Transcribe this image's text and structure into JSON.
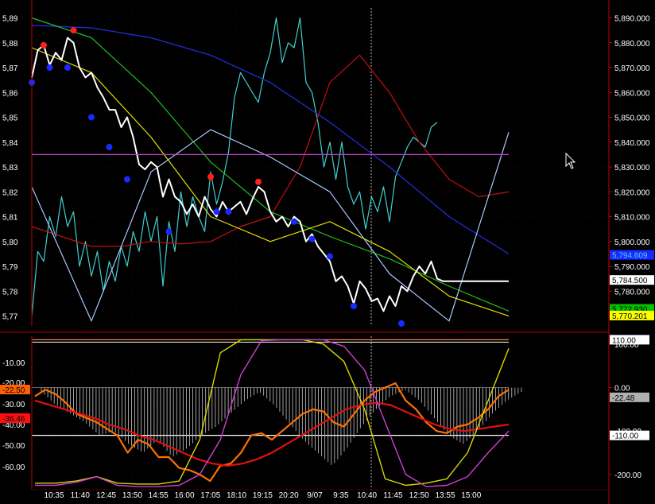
{
  "chart_data": [
    {
      "type": "line",
      "title": "",
      "xlabel": "",
      "ylabel": "",
      "ylim": [
        5766,
        5894
      ],
      "grid": true,
      "x_tick_labels": [
        "10:35",
        "11:40",
        "12:45",
        "13:50",
        "14:55",
        "16:00",
        "17:05",
        "18:10",
        "19:15",
        "20:20",
        "9/07",
        "9:35",
        "10:40",
        "11:45",
        "12:50",
        "13:55",
        "15:00"
      ],
      "y_tick_labels_right": [
        "5,890.000",
        "5,880.000",
        "5,870.000",
        "5,860.000",
        "5,850.000",
        "5,840.000",
        "5,830.000",
        "5,820.000",
        "5,810.000",
        "5,800.000",
        "5,790.000",
        "5,780.000",
        "5,770.000"
      ],
      "y_tick_labels_left": [
        "5,89",
        "5,88",
        "5,87",
        "5,86",
        "5,85",
        "5,84",
        "5,83",
        "5,82",
        "5,81",
        "5,80",
        "5,79",
        "5,78",
        "5,77"
      ],
      "price_tags": [
        {
          "value": "5,794.609",
          "color": "#1a2aff",
          "text_color": "#4ad0ff",
          "y": 5794.6
        },
        {
          "value": "5,784.500",
          "color": "#ffffff",
          "text_color": "#000000",
          "y": 5784.5
        },
        {
          "value": "5,772.930",
          "color": "#00c000",
          "text_color": "#000000",
          "y": 5772.9
        },
        {
          "value": "5,770.201",
          "color": "#ffff00",
          "text_color": "#000000",
          "y": 5770.2
        }
      ],
      "horizontal_line": {
        "y": 5835.0,
        "color": "#c040c0"
      },
      "series": [
        {
          "color": "#ffffff",
          "x": [
            0,
            1,
            2,
            3,
            4,
            5,
            6,
            7,
            8,
            9,
            10,
            11,
            12,
            13,
            14,
            15,
            16,
            17,
            18,
            19,
            20,
            21,
            22,
            23,
            24,
            25,
            26,
            27,
            28,
            29,
            30,
            31,
            32,
            33,
            34,
            35,
            36,
            37,
            38,
            39,
            40,
            41,
            42,
            43,
            44,
            45,
            46,
            47,
            48,
            49,
            50,
            51,
            52,
            53,
            54,
            55,
            56,
            57,
            58,
            59,
            60,
            61,
            62,
            63,
            64,
            65,
            66,
            67,
            68,
            69,
            70,
            71,
            72,
            73,
            74,
            75,
            76,
            77,
            78,
            79,
            80
          ],
          "values": [
            5866,
            5877,
            5879,
            5871,
            5876,
            5873,
            5882,
            5880,
            5870,
            5866,
            5868,
            5862,
            5858,
            5853,
            5853,
            5846,
            5850,
            5842,
            5831,
            5829,
            5832,
            5830,
            5818,
            5825,
            5818,
            5816,
            5811,
            5815,
            5810,
            5818,
            5813,
            5810,
            5816,
            5812,
            5814,
            5816,
            5811,
            5817,
            5822,
            5820,
            5812,
            5808,
            5810,
            5806,
            5810,
            5808,
            5800,
            5803,
            5798,
            5795,
            5792,
            5784,
            5786,
            5782,
            5775,
            5784,
            5781,
            5776,
            5777,
            5772,
            5778,
            5774,
            5782,
            5780,
            5786,
            5790,
            5787,
            5792,
            5785,
            5784,
            5784,
            5784,
            5784,
            5784,
            5784,
            5784,
            5784,
            5784,
            5784,
            5784,
            5784
          ]
        },
        {
          "color": "#40d0d0",
          "x": [
            0,
            1,
            2,
            3,
            4,
            5,
            6,
            7,
            8,
            9,
            10,
            11,
            12,
            13,
            14,
            15,
            16,
            17,
            18,
            19,
            20,
            21,
            22,
            23,
            24,
            25,
            26,
            27,
            28,
            29,
            30,
            31,
            32,
            33,
            34,
            35,
            36,
            37,
            38,
            39,
            40,
            41,
            42,
            43,
            44,
            45,
            46,
            47,
            48,
            49,
            50,
            51,
            52,
            53,
            54,
            55,
            56,
            57,
            58,
            59,
            60,
            61,
            62,
            63,
            64,
            65,
            66,
            67,
            68
          ],
          "values": [
            5770,
            5796,
            5792,
            5810,
            5802,
            5818,
            5806,
            5812,
            5790,
            5800,
            5786,
            5796,
            5780,
            5792,
            5784,
            5798,
            5790,
            5804,
            5796,
            5812,
            5800,
            5810,
            5782,
            5808,
            5796,
            5820,
            5806,
            5818,
            5810,
            5804,
            5828,
            5815,
            5824,
            5836,
            5858,
            5868,
            5864,
            5860,
            5856,
            5868,
            5876,
            5890,
            5872,
            5880,
            5878,
            5890,
            5864,
            5860,
            5848,
            5830,
            5840,
            5825,
            5840,
            5822,
            5815,
            5820,
            5805,
            5818,
            5812,
            5822,
            5808,
            5826,
            5832,
            5838,
            5842,
            5840,
            5838,
            5846,
            5848
          ]
        },
        {
          "color": "#c01010",
          "x": [
            0,
            5,
            10,
            15,
            20,
            25,
            30,
            35,
            40,
            45,
            50,
            55,
            60,
            65,
            70,
            75,
            80
          ],
          "values": [
            5806,
            5802,
            5798,
            5798,
            5800,
            5799,
            5800,
            5806,
            5810,
            5830,
            5864,
            5875,
            5860,
            5840,
            5825,
            5818,
            5820
          ]
        },
        {
          "color": "#2030e0",
          "x": [
            0,
            10,
            20,
            30,
            40,
            50,
            60,
            70,
            80
          ],
          "values": [
            5887,
            5886,
            5882,
            5875,
            5864,
            5848,
            5830,
            5810,
            5795
          ]
        },
        {
          "color": "#20c020",
          "x": [
            0,
            10,
            20,
            30,
            40,
            50,
            60,
            70,
            80
          ],
          "values": [
            5890,
            5882,
            5860,
            5832,
            5812,
            5802,
            5793,
            5782,
            5772
          ]
        },
        {
          "color": "#e0e000",
          "x": [
            0,
            10,
            20,
            30,
            40,
            50,
            60,
            70,
            80
          ],
          "values": [
            5878,
            5868,
            5842,
            5810,
            5800,
            5808,
            5796,
            5778,
            5770
          ]
        },
        {
          "color": "#a8c8ff",
          "x": [
            0,
            10,
            20,
            30,
            40,
            50,
            60,
            70,
            80
          ],
          "values": [
            5822,
            5768,
            5828,
            5845,
            5834,
            5820,
            5787,
            5768,
            5844
          ]
        }
      ],
      "dots": [
        {
          "color": "#ff2020",
          "points": [
            [
              2,
              5879
            ],
            [
              7,
              5885
            ],
            [
              30,
              5826
            ],
            [
              38,
              5824
            ]
          ]
        },
        {
          "color": "#1a2aff",
          "points": [
            [
              0,
              5864
            ],
            [
              3,
              5870
            ],
            [
              6,
              5870
            ],
            [
              10,
              5850
            ],
            [
              13,
              5838
            ],
            [
              16,
              5825
            ],
            [
              23,
              5804
            ],
            [
              31,
              5812
            ],
            [
              33,
              5812
            ],
            [
              44,
              5808
            ],
            [
              47,
              5801
            ],
            [
              50,
              5794
            ],
            [
              54,
              5774
            ],
            [
              62,
              5767
            ]
          ]
        }
      ]
    },
    {
      "type": "line",
      "title": "",
      "xlabel": "",
      "ylabel": "",
      "ylim": [
        -235,
        118
      ],
      "y_tick_labels_left": [
        "-10.00",
        "-20.00",
        "-30.00",
        "-40.00",
        "-50.00",
        "-60.00"
      ],
      "y_tick_labels_right": [
        "100.00",
        "0.00",
        "-100.00",
        "-200.00"
      ],
      "value_tags_left": [
        {
          "value": "-22.50",
          "color": "#ff6000"
        },
        {
          "value": "-36.46",
          "color": "#ff1010"
        }
      ],
      "value_tags_right": [
        {
          "value": "110.00",
          "color": "#ffffff"
        },
        {
          "value": "-22.48",
          "color": "#b0b0b0"
        },
        {
          "value": "-110.00",
          "color": "#ffffff"
        }
      ],
      "reference_levels": [
        110,
        -110
      ],
      "series": [
        {
          "color": "#ff7000",
          "values": [
            -20,
            -5,
            -15,
            -35,
            -60,
            -70,
            -80,
            -95,
            -110,
            -150,
            -120,
            -130,
            -160,
            -160,
            -185,
            -190,
            -200,
            -215,
            -180,
            -175,
            -150,
            -110,
            -105,
            -120,
            -100,
            -80,
            -60,
            -50,
            -55,
            -80,
            -90,
            -60,
            -30,
            -10,
            0,
            10,
            -30,
            -50,
            -80,
            -100,
            -105,
            -90,
            -85,
            -70,
            -50,
            -20,
            -5
          ]
        },
        {
          "color": "#e01010",
          "values": [
            -30,
            -40,
            -50,
            -60,
            -70,
            -85,
            -95,
            -110,
            -120,
            -135,
            -150,
            -165,
            -175,
            -180,
            -175,
            -165,
            -150,
            -130,
            -110,
            -90,
            -70,
            -50,
            -40,
            -35,
            -40,
            -55,
            -70,
            -85,
            -95,
            -100,
            -95,
            -90,
            -85
          ]
        },
        {
          "color": "#e0e0e0",
          "values": [
            -10,
            -40,
            -60,
            -80,
            -110,
            -100,
            -130,
            -150,
            -120,
            -160,
            -140,
            -110,
            -90,
            -60,
            -30,
            -10,
            -40,
            -80,
            -120,
            -150,
            -180,
            -140,
            -90,
            -50,
            -20,
            -5,
            -30,
            -70,
            -110,
            -130,
            -100,
            -60,
            -30,
            -10
          ]
        },
        {
          "color": "#d8d800",
          "values": [
            -220,
            -220,
            -215,
            -205,
            -220,
            -222,
            -222,
            -215,
            -120,
            80,
            110,
            110,
            110,
            110,
            100,
            60,
            -50,
            -210,
            -225,
            -220,
            -210,
            -150,
            -30,
            90
          ]
        },
        {
          "color": "#d040d0",
          "values": [
            -225,
            -225,
            -218,
            -205,
            -225,
            -228,
            -228,
            -225,
            -200,
            -120,
            30,
            108,
            110,
            110,
            110,
            95,
            40,
            -80,
            -200,
            -228,
            -225,
            -205,
            -150,
            -100
          ]
        }
      ]
    }
  ]
}
